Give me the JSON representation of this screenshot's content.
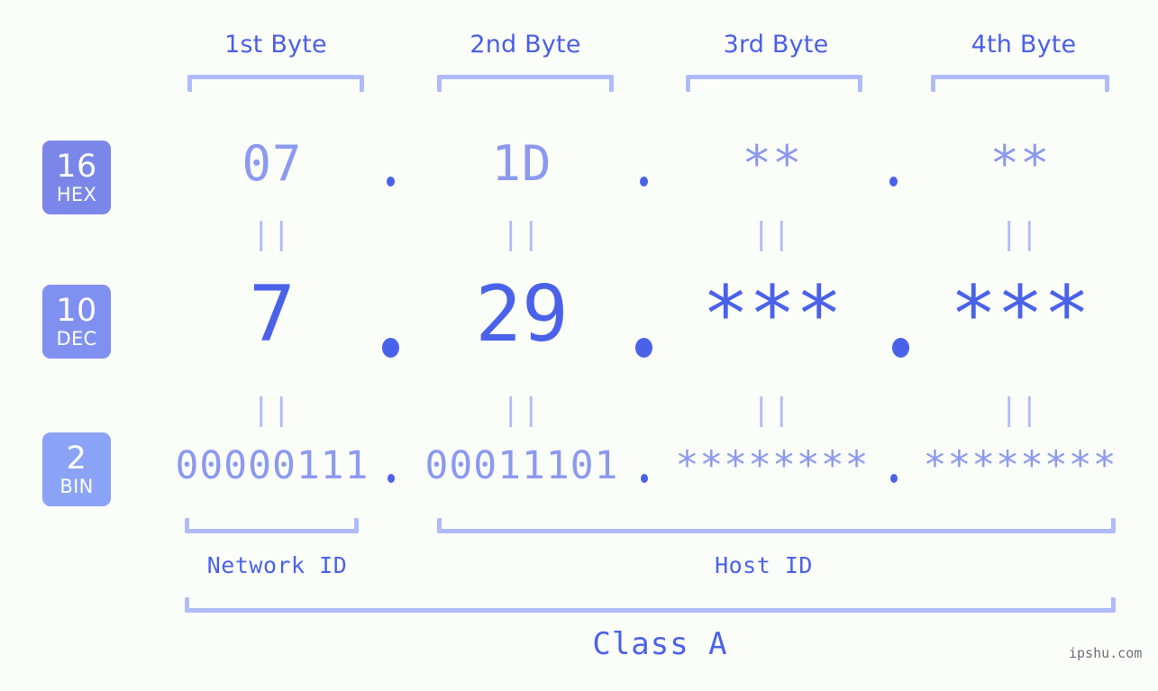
{
  "meta": {
    "watermark": "ipshu.com",
    "background_color": "#fbfdf8",
    "accent_strong": "#4a62ea",
    "accent_light": "#8b99ef",
    "accent_bracket": "#b0bbf9"
  },
  "columns": [
    {
      "heading": "1st Byte"
    },
    {
      "heading": "2nd Byte"
    },
    {
      "heading": "3rd Byte"
    },
    {
      "heading": "4th Byte"
    }
  ],
  "rows": [
    {
      "badge_number": "16",
      "badge_name": "HEX",
      "badge_color": "#7b87e8",
      "values": [
        "07",
        "1D",
        "**",
        "**"
      ],
      "separator": "."
    },
    {
      "badge_number": "10",
      "badge_name": "DEC",
      "badge_color": "#8090f0",
      "values": [
        "7",
        "29",
        "***",
        "***"
      ],
      "separator": "."
    },
    {
      "badge_number": "2",
      "badge_name": "BIN",
      "badge_color": "#8ba3f7",
      "values": [
        "00000111",
        "00011101",
        "********",
        "********"
      ],
      "separator": "."
    }
  ],
  "equals_mark": "||",
  "segments": {
    "network_id": "Network ID",
    "host_id": "Host ID",
    "class": "Class A"
  }
}
